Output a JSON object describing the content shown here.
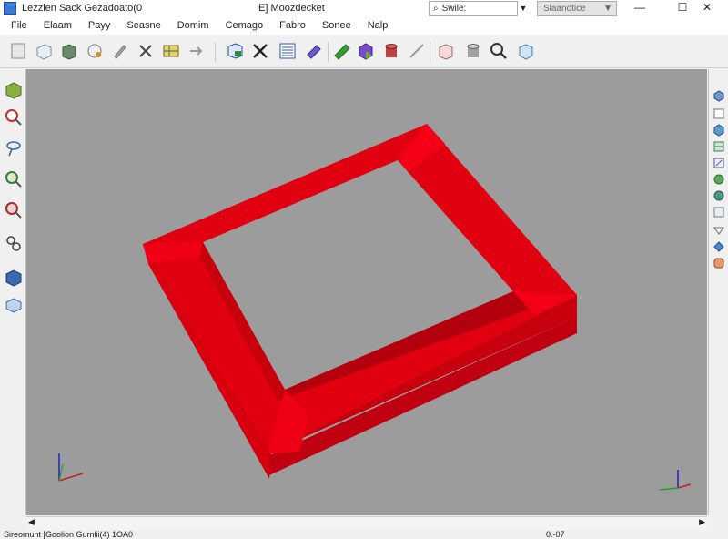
{
  "window": {
    "app_title": "Lezzlen Sack Gezadoato(0",
    "doc_title": "E] Moozdecket",
    "search_placeholder": "Swile:",
    "combo_value": "Slaanotice",
    "buttons": {
      "minimize": "—",
      "maximize": "☐",
      "close": "✕"
    }
  },
  "menu": [
    "File",
    "Elaam",
    "Payy",
    "Seasne",
    "Domim",
    "Cemago",
    "Fabro",
    "Sonee",
    "Nalp"
  ],
  "toolbar": {
    "icons": [
      "new-file-icon",
      "box-outline-icon",
      "solid-cube-icon",
      "gear-sketch-icon",
      "pencil-icon",
      "delete-x-icon",
      "grid-table-icon",
      "arrow-right-icon",
      "import-box-icon",
      "close-x-icon",
      "spreadsheet-icon",
      "purple-prism-icon",
      "green-bar-icon",
      "purple-solid-icon",
      "red-cylinder-icon",
      "line-tool-icon",
      "pink-box-icon",
      "gray-cylinder-icon",
      "magnifier-icon",
      "blue-cube-icon"
    ]
  },
  "left_tools": [
    "sketch-box-icon",
    "zoom-red-icon",
    "lasso-icon",
    "zoom-fit-icon",
    "zoom-window-icon",
    "lock-icon",
    "blue-cube-icon",
    "layer-box-icon"
  ],
  "right_tools": [
    "view-iso-icon",
    "view-blank-icon",
    "view-hex-icon",
    "view-grid-icon",
    "view-edit-icon",
    "view-globe-icon",
    "view-globe2-icon",
    "view-square-icon",
    "view-triangle-icon",
    "view-diamond-icon",
    "view-orange-icon"
  ],
  "status": {
    "text": "Sireomunt [Goolion Gurnlii(4) 1OA0",
    "coords": "0.-07",
    "colors": {
      "model": "#e8000f",
      "viewport": "#9c9c9c"
    }
  }
}
